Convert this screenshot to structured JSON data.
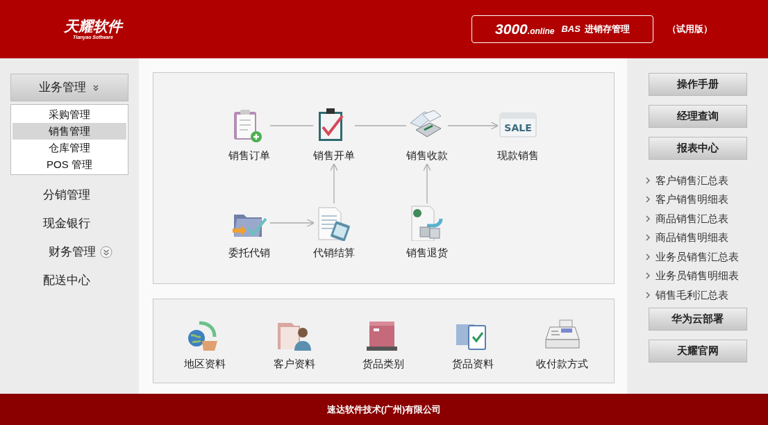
{
  "header": {
    "logo": {
      "name": "天耀软件",
      "subtitle": "Tianyao Software"
    },
    "product": {
      "number": "3000",
      "suffix": ".online",
      "code": "BAS",
      "name": "进销存管理"
    },
    "edition": "（试用版）"
  },
  "sidebar": {
    "items": [
      {
        "label": "业务管理",
        "kind": "group",
        "expanded": true,
        "children": [
          {
            "label": "采购管理",
            "selected": false
          },
          {
            "label": "销售管理",
            "selected": true
          },
          {
            "label": "仓库管理",
            "selected": false
          },
          {
            "label": "POS 管理",
            "selected": false
          }
        ]
      },
      {
        "label": "分销管理",
        "kind": "link"
      },
      {
        "label": "现金银行",
        "kind": "link"
      },
      {
        "label": "财务管理",
        "kind": "group",
        "expanded": false
      },
      {
        "label": "配送中心",
        "kind": "link"
      }
    ]
  },
  "flow": {
    "nodes": [
      {
        "label": "销售订单"
      },
      {
        "label": "销售开单"
      },
      {
        "label": "销售收款"
      },
      {
        "label": "现款销售",
        "sign_text": "SALE"
      },
      {
        "label": "委托代销"
      },
      {
        "label": "代销结算"
      },
      {
        "label": "销售退货"
      }
    ]
  },
  "basics": [
    {
      "label": "地区资料"
    },
    {
      "label": "客户资料"
    },
    {
      "label": "货品类别"
    },
    {
      "label": "货品资料"
    },
    {
      "label": "收付款方式"
    }
  ],
  "right_panel": {
    "top_buttons": [
      "操作手册",
      "经理查询",
      "报表中心"
    ],
    "reports": [
      "客户销售汇总表",
      "客户销售明细表",
      "商品销售汇总表",
      "商品销售明细表",
      "业务员销售汇总表",
      "业务员销售明细表",
      "销售毛利汇总表"
    ],
    "bottom_buttons": [
      "华为云部署",
      "天耀官网"
    ]
  },
  "footer": "速达软件技术(广州)有限公司"
}
